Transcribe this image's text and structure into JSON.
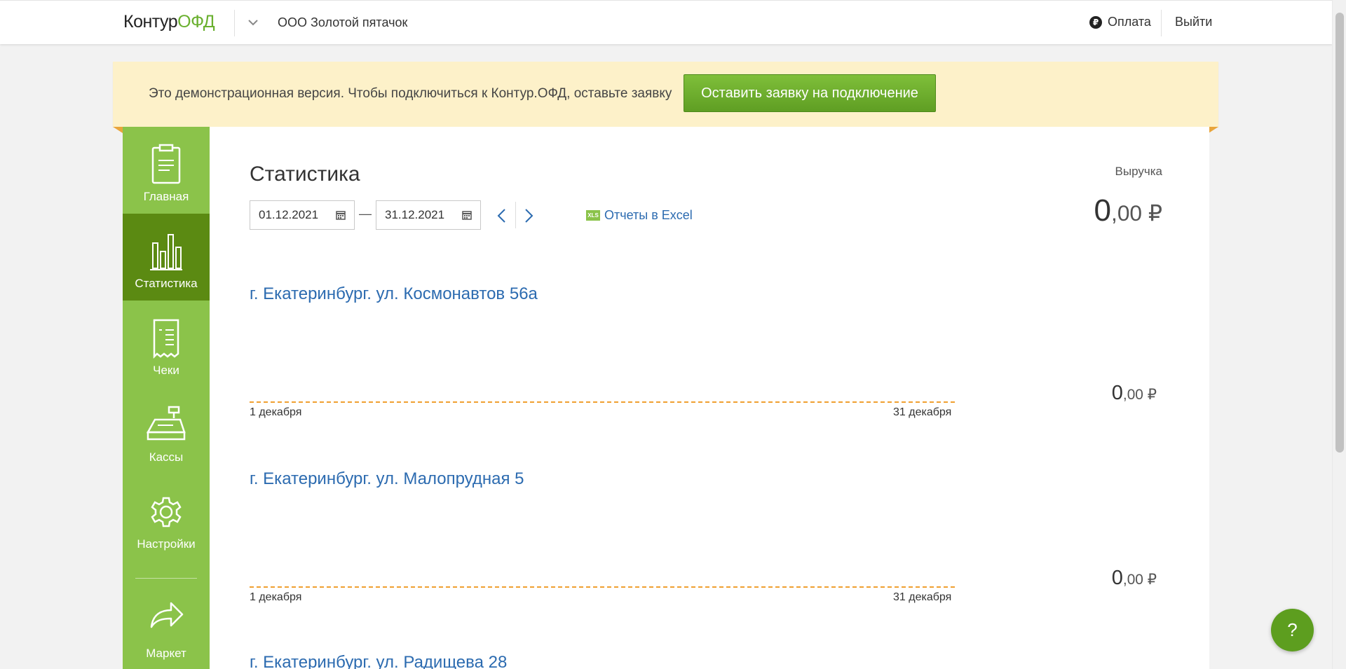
{
  "header": {
    "logo_kontur": "Контур",
    "logo_ofd": "ОФД",
    "organization": "ООО Золотой пятачок",
    "payment_label": "Оплата",
    "payment_icon_glyph": "₽",
    "logout_label": "Выйти"
  },
  "banner": {
    "text": "Это демонстрационная версия. Чтобы подключиться к Контур.ОФД, оставьте заявку",
    "button_label": "Оставить заявку на подключение"
  },
  "sidebar": {
    "items": [
      {
        "label": "Главная",
        "icon": "clipboard-icon"
      },
      {
        "label": "Статистика",
        "icon": "bar-chart-icon",
        "active": true
      },
      {
        "label": "Чеки",
        "icon": "receipt-icon"
      },
      {
        "label": "Кассы",
        "icon": "cash-register-icon"
      },
      {
        "label": "Настройки",
        "icon": "gear-icon"
      },
      {
        "label": "Маркет",
        "icon": "share-arrow-icon"
      }
    ]
  },
  "main": {
    "title": "Статистика",
    "date_from": "01.12.2021",
    "date_to": "31.12.2021",
    "date_separator": "—",
    "excel_icon_text": "XLS",
    "excel_link": "Отчеты в Excel",
    "revenue_label": "Выручка",
    "revenue_total_int": "0",
    "revenue_total_dec": ",00 ₽",
    "locations": [
      {
        "name": "г. Екатеринбург. ул. Космонавтов 56а",
        "start": "1 декабря",
        "end": "31 декабря",
        "sum_int": "0",
        "sum_dec": ",00 ₽"
      },
      {
        "name": "г. Екатеринбург. ул. Малопрудная 5",
        "start": "1 декабря",
        "end": "31 декабря",
        "sum_int": "0",
        "sum_dec": ",00 ₽"
      },
      {
        "name": "г. Екатеринбург. ул. Радищева 28"
      }
    ]
  },
  "help_label": "?"
}
